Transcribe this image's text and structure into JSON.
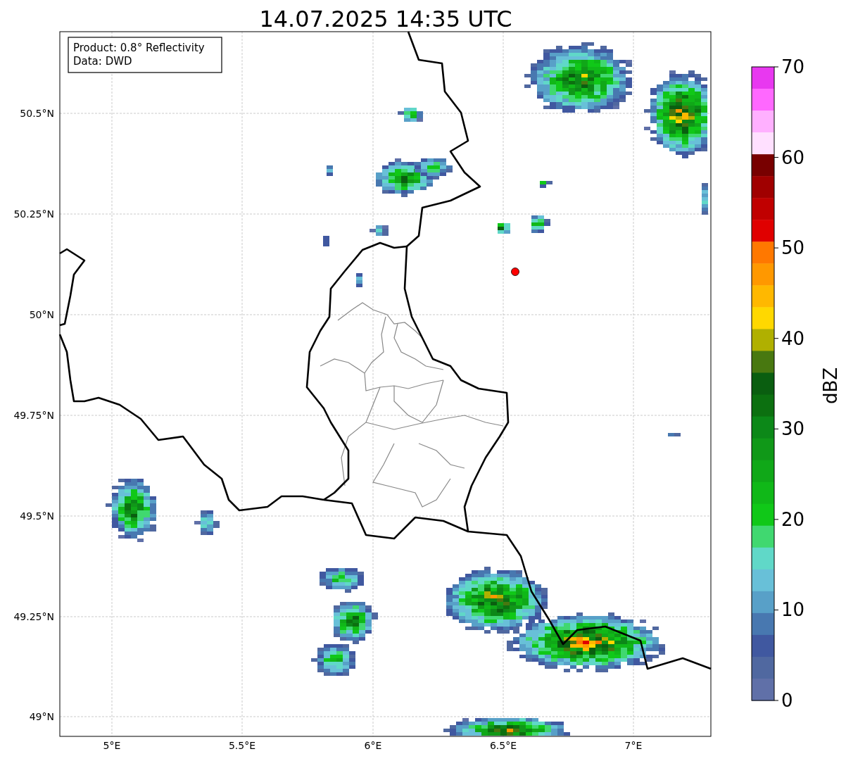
{
  "title": "14.07.2025 14:35 UTC",
  "info_box": [
    "Product: 0.8° Reflectivity",
    "Data: DWD"
  ],
  "map": {
    "xticks": [
      "5°E",
      "5.5°E",
      "6°E",
      "6.5°E",
      "7°E"
    ],
    "yticks": [
      "50.5°N",
      "50.25°N",
      "50°N",
      "49.75°N",
      "49.5°N",
      "49.25°N",
      "49°N"
    ]
  },
  "colorbar": {
    "label": "dBZ",
    "ticks": [
      "70",
      "60",
      "50",
      "40",
      "30",
      "20",
      "10",
      "0"
    ],
    "bins": [
      {
        "color": "#e838f0"
      },
      {
        "color": "#ff68ff"
      },
      {
        "color": "#ffb0ff"
      },
      {
        "color": "#ffe0ff"
      },
      {
        "color": "#780000"
      },
      {
        "color": "#a00000"
      },
      {
        "color": "#c00000"
      },
      {
        "color": "#e00000"
      },
      {
        "color": "#ff7800"
      },
      {
        "color": "#ff9800"
      },
      {
        "color": "#ffb800"
      },
      {
        "color": "#ffd800"
      },
      {
        "color": "#b0b000"
      },
      {
        "color": "#487810"
      },
      {
        "color": "#0a5e10"
      },
      {
        "color": "#0c7010"
      },
      {
        "color": "#0c8818"
      },
      {
        "color": "#109818"
      },
      {
        "color": "#10a818"
      },
      {
        "color": "#10b818"
      },
      {
        "color": "#10c818"
      },
      {
        "color": "#40d870"
      },
      {
        "color": "#60d8c8"
      },
      {
        "color": "#68c0d8"
      },
      {
        "color": "#58a0c8"
      },
      {
        "color": "#4878b0"
      },
      {
        "color": "#4058a0"
      },
      {
        "color": "#5068a0"
      },
      {
        "color": "#6070a8"
      }
    ]
  }
}
